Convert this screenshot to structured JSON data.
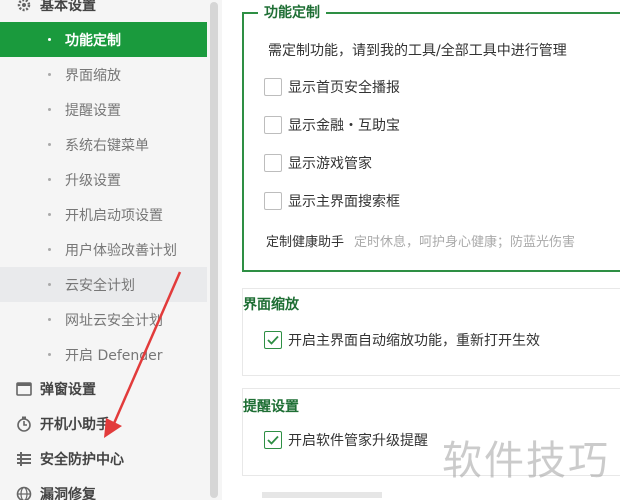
{
  "sidebar": {
    "section_basic": "基本设置",
    "items": [
      {
        "label": "功能定制"
      },
      {
        "label": "界面缩放"
      },
      {
        "label": "提醒设置"
      },
      {
        "label": "系统右键菜单"
      },
      {
        "label": "升级设置"
      },
      {
        "label": "开机启动项设置"
      },
      {
        "label": "用户体验改善计划"
      },
      {
        "label": "云安全计划"
      },
      {
        "label": "网址云安全计划"
      },
      {
        "label": "开启 Defender"
      }
    ],
    "sections": [
      {
        "label": "弹窗设置",
        "icon": "window-icon"
      },
      {
        "label": "开机小助手",
        "icon": "clock-icon"
      },
      {
        "label": "安全防护中心",
        "icon": "shield-list-icon"
      },
      {
        "label": "漏洞修复",
        "icon": "globe-icon"
      }
    ]
  },
  "main": {
    "customize": {
      "title": "功能定制",
      "description": "需定制功能，请到我的工具/全部工具中进行管理",
      "options": [
        {
          "label": "显示首页安全播报",
          "checked": false
        },
        {
          "label": "显示金融・互助宝",
          "checked": false
        },
        {
          "label": "显示游戏管家",
          "checked": false
        },
        {
          "label": "显示主界面搜索框",
          "checked": false
        }
      ],
      "health_label": "定制健康助手",
      "health_hint": "定时休息，呵护身心健康；防蓝光伤害"
    },
    "zoom": {
      "title": "界面缩放",
      "option": {
        "label": "开启主界面自动缩放功能，重新打开生效",
        "checked": true
      }
    },
    "reminder": {
      "title": "提醒设置",
      "option": {
        "label": "开启软件管家升级提醒",
        "checked": true
      }
    }
  },
  "watermark": "软件技巧",
  "colors": {
    "accent": "#1a9a3d",
    "annotation_arrow": "#e23b3b"
  }
}
